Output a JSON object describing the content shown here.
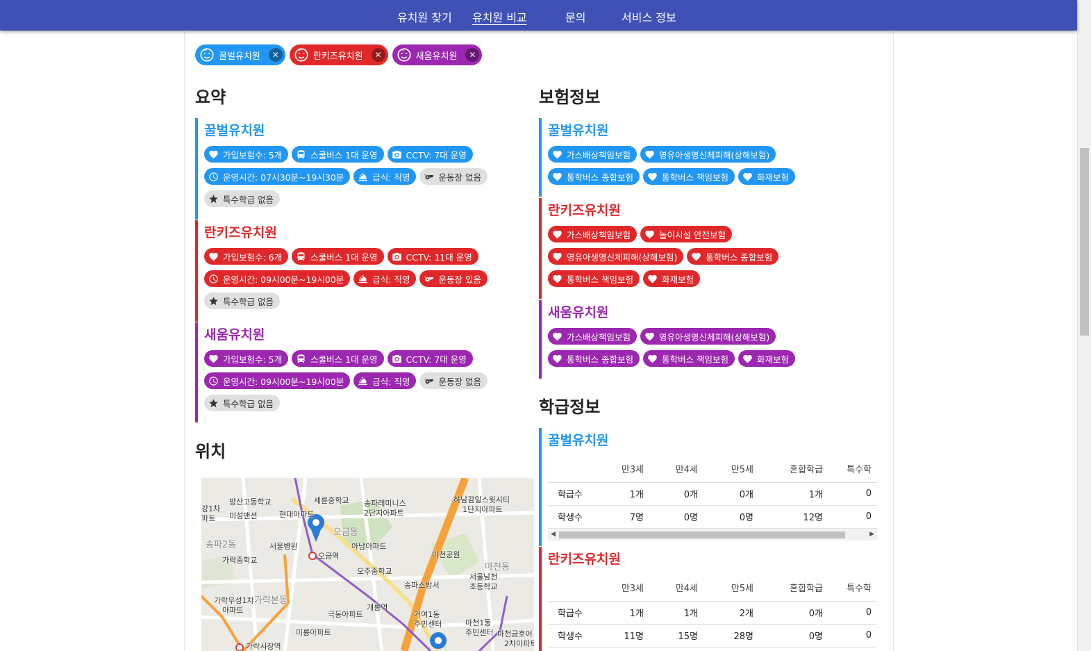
{
  "nav": {
    "items": [
      {
        "label": "유치원 찾기",
        "active": false
      },
      {
        "label": "유치원 비교",
        "active": true
      },
      {
        "label": "문의",
        "active": false
      },
      {
        "label": "서비스 정보",
        "active": false
      }
    ]
  },
  "colors": {
    "nav": "#3f51b5",
    "blue": "#2196f3",
    "red": "#e0282a",
    "purple": "#9c27b0",
    "gray_tag": "#e0e0e0"
  },
  "chips": [
    {
      "label": "꿀벌유치원",
      "color": "#2196f3"
    },
    {
      "label": "란키즈유치원",
      "color": "#e0282a"
    },
    {
      "label": "새움유치원",
      "color": "#9c27b0"
    }
  ],
  "summary": {
    "title": "요약",
    "kindergartens": [
      {
        "name": "꿀벌유치원",
        "color": "#2196f3",
        "insurance_count": "가입보험수: 5개",
        "school_bus": "스쿨버스 1대 운영",
        "cctv": "CCTV: 7대 운영",
        "hours": "운영시간: 07시30분~19시30분",
        "meal": "급식: 직영",
        "playground": "운동장 없음",
        "playground_has": false,
        "special_class": "특수학급 없음"
      },
      {
        "name": "란키즈유치원",
        "color": "#e0282a",
        "insurance_count": "가입보험수: 6개",
        "school_bus": "스쿨버스 1대 운영",
        "cctv": "CCTV: 11대 운영",
        "hours": "운영시간: 09시00분~19시00분",
        "meal": "급식: 직영",
        "playground": "운동장 있음",
        "playground_has": true,
        "special_class": "특수학급 없음"
      },
      {
        "name": "새움유치원",
        "color": "#9c27b0",
        "insurance_count": "가입보험수: 5개",
        "school_bus": "스쿨버스 1대 운영",
        "cctv": "CCTV: 7대 운영",
        "hours": "운영시간: 09시00분~19시00분",
        "meal": "급식: 직영",
        "playground": "운동장 없음",
        "playground_has": false,
        "special_class": "특수학급 없음"
      }
    ]
  },
  "insurance": {
    "title": "보험정보",
    "kindergartens": [
      {
        "name": "꿀벌유치원",
        "color": "#2196f3",
        "rows": [
          [
            "가스배상책임보험",
            "영유아생명신체피해(상해보험)"
          ],
          [
            "통학버스 종합보험",
            "통학버스 책임보험",
            "화재보험"
          ]
        ]
      },
      {
        "name": "란키즈유치원",
        "color": "#e0282a",
        "rows": [
          [
            "가스배상책임보험",
            "놀이시설 안전보험"
          ],
          [
            "영유아생명신체피해(상해보험)",
            "통학버스 종합보험"
          ],
          [
            "통학버스 책임보험",
            "화재보험"
          ]
        ]
      },
      {
        "name": "새움유치원",
        "color": "#9c27b0",
        "rows": [
          [
            "가스배상책임보험",
            "영유아생명신체피해(상해보험)"
          ],
          [
            "통학버스 종합보험",
            "통학버스 책임보험",
            "화재보험"
          ]
        ]
      }
    ]
  },
  "location": {
    "title": "위치",
    "map_labels": [
      "방산고등학교",
      "세륜중학교",
      "송파레미니스",
      "2단지아파트",
      "하남감일스윗시티",
      "1단지아파트",
      "강1차",
      "파트",
      "미성맨션",
      "현대아파트",
      "서울병원",
      "오금역",
      "아남아파트",
      "가락중학교",
      "오주중학교",
      "마천공원",
      "송파소방서",
      "서울남천",
      "초등학교",
      "가락우성1차",
      "아파트",
      "극동아파트",
      "거여1동",
      "주민센터",
      "마천1동",
      "주민센터",
      "미륭아파트",
      "마천금호어",
      "2차아파트",
      "가락시장역",
      "개롱역",
      "송파2동",
      "오금동",
      "가락본동",
      "마천동"
    ]
  },
  "class_info": {
    "title": "학급정보",
    "columns": [
      "",
      "만3세",
      "만4세",
      "만5세",
      "혼합학급",
      "특수학"
    ],
    "kindergartens": [
      {
        "name": "꿀벌유치원",
        "color": "#2196f3",
        "rows": [
          {
            "label": "학급수",
            "values": [
              "1개",
              "0개",
              "0개",
              "1개",
              "0"
            ]
          },
          {
            "label": "학생수",
            "values": [
              "7명",
              "0명",
              "0명",
              "12명",
              "0"
            ]
          }
        ]
      },
      {
        "name": "란키즈유치원",
        "color": "#e0282a",
        "rows": [
          {
            "label": "학급수",
            "values": [
              "1개",
              "1개",
              "2개",
              "0개",
              "0"
            ]
          },
          {
            "label": "학생수",
            "values": [
              "11명",
              "15명",
              "28명",
              "0명",
              "0"
            ]
          }
        ]
      }
    ]
  }
}
